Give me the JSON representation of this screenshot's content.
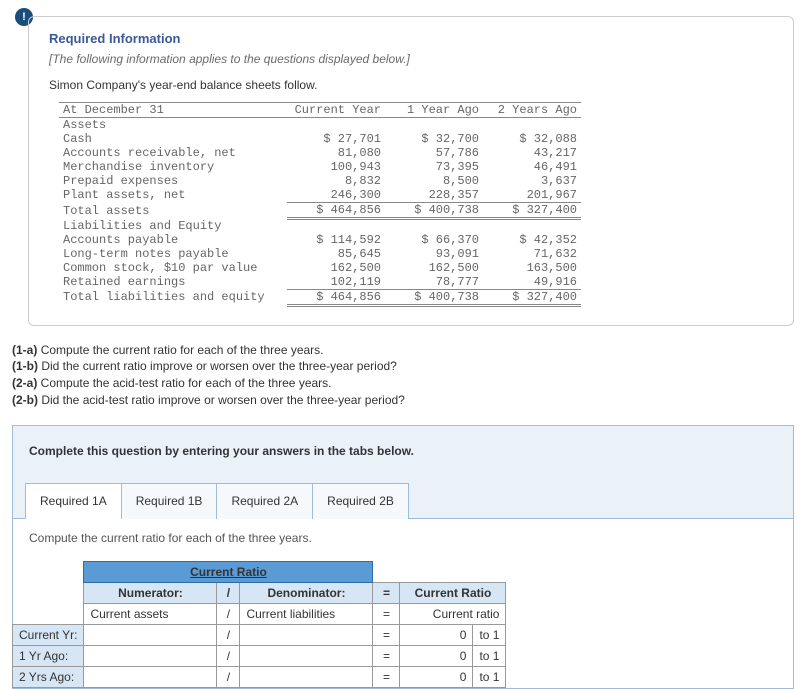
{
  "info_icon": "!",
  "req_title": "Required Information",
  "req_sub": "[The following information applies to the questions displayed below.]",
  "intro": "Simon Company's year-end balance sheets follow.",
  "fin": {
    "header": {
      "c0": "At December 31",
      "c1": "Current Year",
      "c2": "1 Year Ago",
      "c3": "2 Years Ago"
    },
    "assets_hdr": "Assets",
    "rows_assets": [
      {
        "label": "Cash",
        "c1": "$ 27,701",
        "c2": "$ 32,700",
        "c3": "$ 32,088"
      },
      {
        "label": "Accounts receivable, net",
        "c1": "81,080",
        "c2": "57,786",
        "c3": "43,217"
      },
      {
        "label": "Merchandise inventory",
        "c1": "100,943",
        "c2": "73,395",
        "c3": "46,491"
      },
      {
        "label": "Prepaid expenses",
        "c1": "8,832",
        "c2": "8,500",
        "c3": "3,637"
      },
      {
        "label": "Plant assets, net",
        "c1": "246,300",
        "c2": "228,357",
        "c3": "201,967"
      }
    ],
    "total_assets": {
      "label": "Total assets",
      "c1": "$ 464,856",
      "c2": "$ 400,738",
      "c3": "$ 327,400"
    },
    "liab_hdr": "Liabilities and Equity",
    "rows_liab": [
      {
        "label": "Accounts payable",
        "c1": "$ 114,592",
        "c2": "$ 66,370",
        "c3": "$ 42,352"
      },
      {
        "label": "Long-term notes payable",
        "c1": "85,645",
        "c2": "93,091",
        "c3": "71,632"
      },
      {
        "label": "Common stock, $10 par value",
        "c1": "162,500",
        "c2": "162,500",
        "c3": "163,500"
      },
      {
        "label": "Retained earnings",
        "c1": "102,119",
        "c2": "78,777",
        "c3": "49,916"
      }
    ],
    "total_liab": {
      "label": "Total liabilities and equity",
      "c1": "$ 464,856",
      "c2": "$ 400,738",
      "c3": "$ 327,400"
    }
  },
  "questions": {
    "q1a": "(1-a) Compute the current ratio for each of the three years.",
    "q1b": "(1-b) Did the current ratio improve or worsen over the three-year period?",
    "q2a": "(2-a) Compute the acid-test ratio for each of the three years.",
    "q2b": "(2-b) Did the acid-test ratio improve or worsen over the three-year period?"
  },
  "answer_inst": "Complete this question by entering your answers in the tabs below.",
  "tabs": [
    "Required 1A",
    "Required 1B",
    "Required 2A",
    "Required 2B"
  ],
  "tab_prompt": "Compute the current ratio for each of the three years.",
  "ratio": {
    "title": "Current Ratio",
    "h_num": "Numerator:",
    "h_den": "Denominator:",
    "h_res": "Current Ratio",
    "slash": "/",
    "eq": "=",
    "row_labels": [
      "",
      "Current Yr:",
      "1 Yr Ago:",
      "2 Yrs Ago:"
    ],
    "r0_num": "Current assets",
    "r0_den": "Current liabilities",
    "r0_res": "Current ratio",
    "to1": "to 1",
    "zero": "0"
  }
}
